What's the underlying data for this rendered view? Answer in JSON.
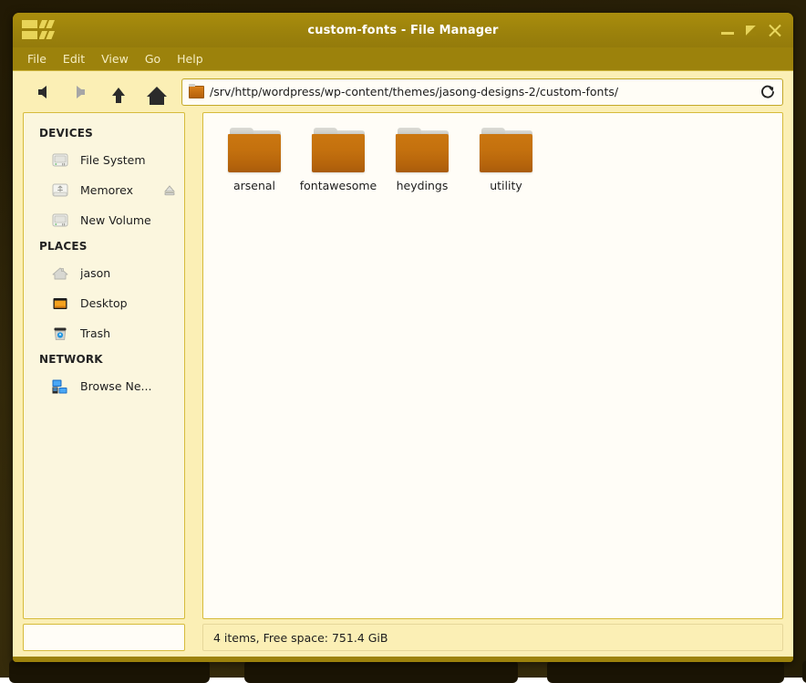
{
  "window": {
    "title": "custom-fonts - File Manager",
    "menu_icon": "window-menu-icon",
    "controls": {
      "minimize": "minimize-button",
      "maximize": "maximize-button",
      "close": "close-button"
    },
    "accent_color": "#9c820c",
    "toolbar_bg": "#fbefb5",
    "folder_color": "#c3700e"
  },
  "menubar": {
    "items": [
      {
        "label": "File"
      },
      {
        "label": "Edit"
      },
      {
        "label": "View"
      },
      {
        "label": "Go"
      },
      {
        "label": "Help"
      }
    ]
  },
  "toolbar": {
    "back": "back-arrow-icon",
    "forward": "forward-arrow-icon",
    "up": "up-arrow-icon",
    "home": "home-icon",
    "path": "/srv/http/wordpress/wp-content/themes/jasong-designs-2/custom-fonts/",
    "reload": "reload-icon"
  },
  "sidebar": {
    "groups": [
      {
        "header": "DEVICES",
        "items": [
          {
            "label": "File System",
            "icon": "harddisk-icon",
            "eject": false
          },
          {
            "label": "Memorex",
            "icon": "usb-drive-icon",
            "eject": true
          },
          {
            "label": "New Volume",
            "icon": "harddisk-icon",
            "eject": false
          }
        ]
      },
      {
        "header": "PLACES",
        "items": [
          {
            "label": "jason",
            "icon": "home-folder-icon",
            "eject": false
          },
          {
            "label": "Desktop",
            "icon": "desktop-icon",
            "eject": false
          },
          {
            "label": "Trash",
            "icon": "trash-icon",
            "eject": false
          }
        ]
      },
      {
        "header": "NETWORK",
        "items": [
          {
            "label": "Browse Ne...",
            "icon": "network-icon",
            "eject": false
          }
        ]
      }
    ]
  },
  "files": {
    "items": [
      {
        "name": "arsenal",
        "type": "folder"
      },
      {
        "name": "fontawesome",
        "type": "folder"
      },
      {
        "name": "heydings",
        "type": "folder"
      },
      {
        "name": "utility",
        "type": "folder"
      }
    ]
  },
  "status": {
    "text": "4 items, Free space: 751.4 GiB"
  }
}
